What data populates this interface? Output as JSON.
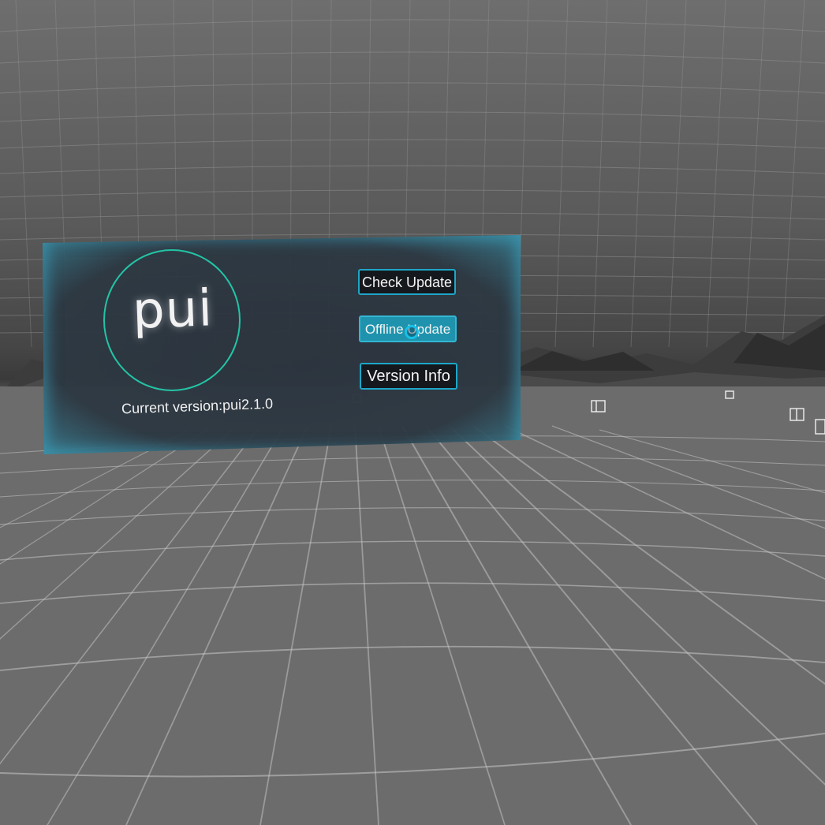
{
  "panel": {
    "logo_text": "pui",
    "current_version": "Current version:pui2.1.0"
  },
  "buttons": {
    "check_update": "Check Update",
    "offline_update": "Offline Update",
    "version_info": "Version Info"
  },
  "colors": {
    "accent": "#1ea6c8",
    "logo_ring": "#23c4a6",
    "offline_button_fill": "#1f93ad",
    "button_fill": "#15181c"
  },
  "icons": {
    "cursor": "gaze-pointer-icon"
  }
}
